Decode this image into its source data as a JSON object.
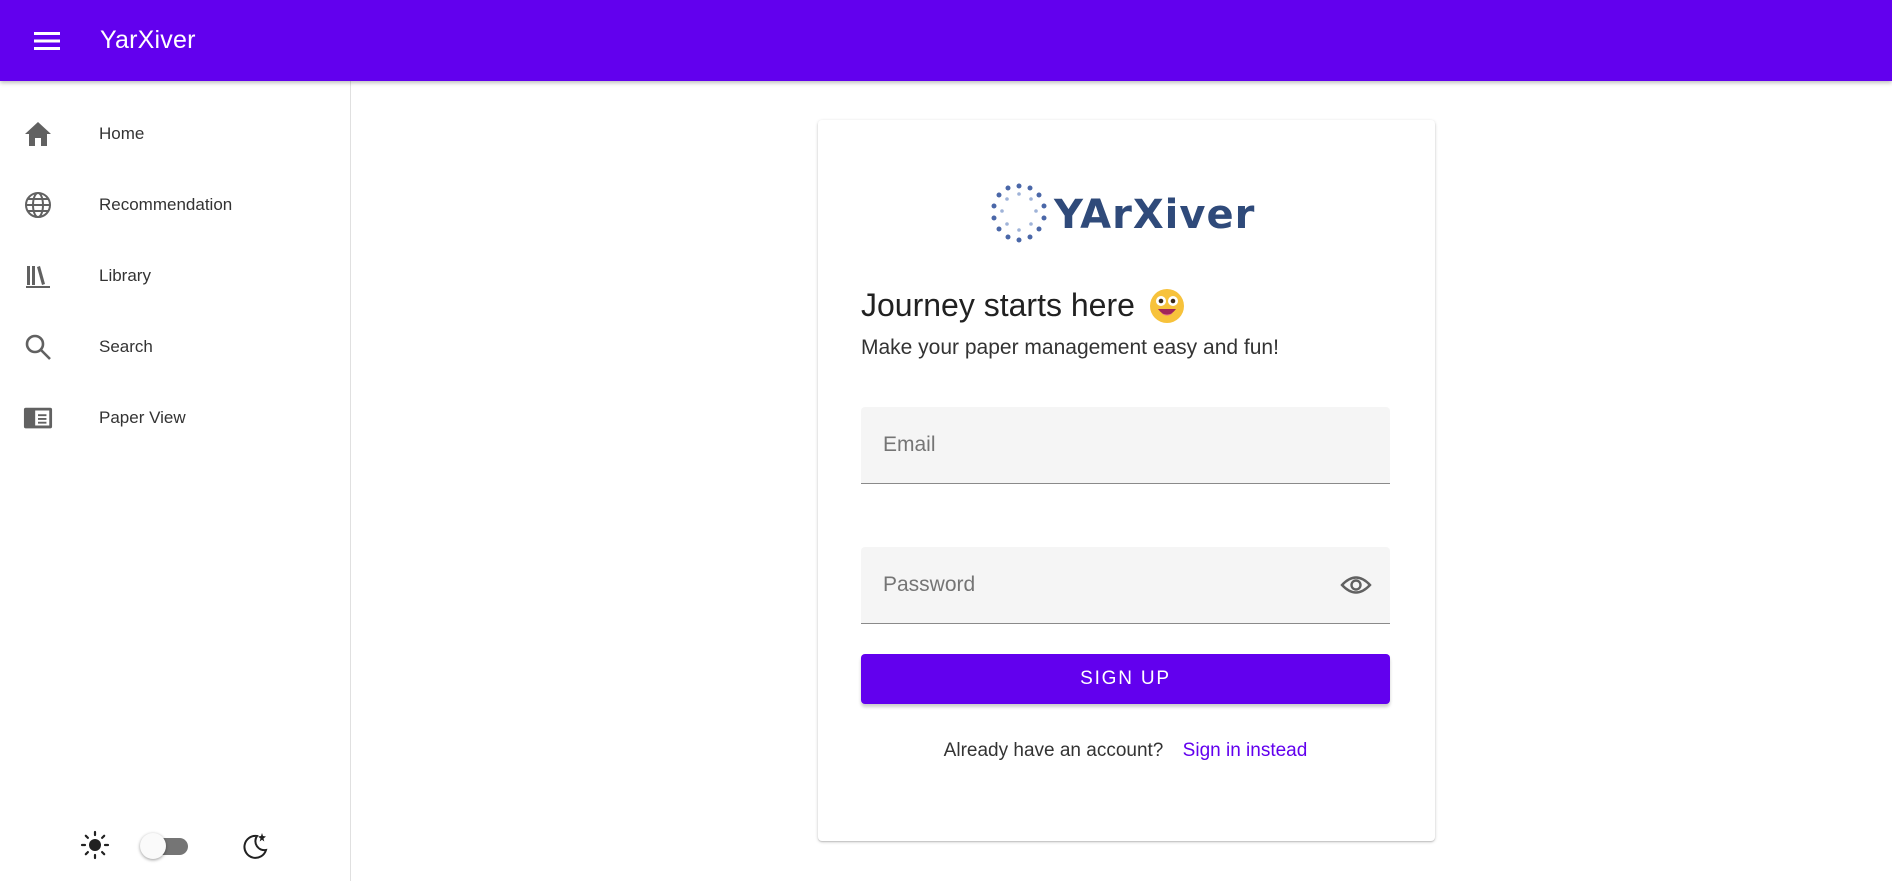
{
  "app": {
    "title": "YarXiver"
  },
  "sidebar": {
    "items": [
      {
        "label": "Home",
        "icon": "home-icon"
      },
      {
        "label": "Recommendation",
        "icon": "globe-icon"
      },
      {
        "label": "Library",
        "icon": "library-icon"
      },
      {
        "label": "Search",
        "icon": "search-icon"
      },
      {
        "label": "Paper View",
        "icon": "paper-view-icon"
      }
    ],
    "theme_toggle": {
      "dark_mode": false
    }
  },
  "card": {
    "logo_text": "YArXiver",
    "headline": "Journey starts here",
    "subline": "Make your paper management easy and fun!",
    "email": {
      "placeholder": "Email",
      "value": ""
    },
    "password": {
      "placeholder": "Password",
      "value": ""
    },
    "signup_label": "SIGN UP",
    "signin_prompt": "Already have an account?",
    "signin_link": "Sign in instead"
  },
  "colors": {
    "primary": "#6200ee",
    "logo": "#2f4a7a"
  }
}
